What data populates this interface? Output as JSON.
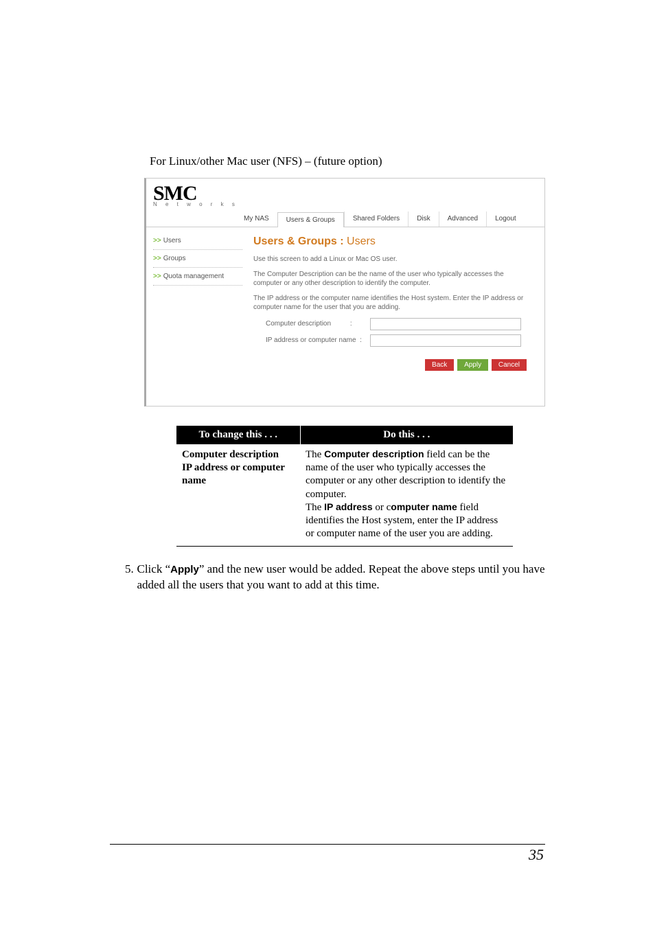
{
  "intro": "For Linux/other Mac user (NFS) – (future option)",
  "logo": {
    "text": "SMC",
    "sub": "N e t w o r k s"
  },
  "tabs": {
    "my_nas": "My NAS",
    "users_groups": "Users & Groups",
    "shared_folders": "Shared Folders",
    "disk": "Disk",
    "advanced": "Advanced",
    "logout": "Logout"
  },
  "sidebar": {
    "users": "Users",
    "groups": "Groups",
    "quota": "Quota management"
  },
  "panel": {
    "title_bold": "Users & Groups : ",
    "title_light": "Users",
    "d1": "Use this screen to add a Linux or Mac OS user.",
    "d2": "The Computer Description can be the name of the user who typically accesses the computer or any other description to identify the computer.",
    "d3": "The IP address or the computer name identifies the Host system. Enter the IP address or computer name for the user that you are adding.",
    "f_comp_desc": "Computer description",
    "f_ip": "IP address or computer name",
    "colon": ":",
    "btn_back": "Back",
    "btn_apply": "Apply",
    "btn_cancel": "Cancel"
  },
  "table": {
    "h1": "To change this . . .",
    "h2": "Do this . . .",
    "left": "Computer description\nIP address or computer name",
    "r_t1a": "The ",
    "r_t1b": "Computer description",
    "r_t1c": " field can be the name of the user who typically accesses the computer or any other description to identify the computer.",
    "r_t2a": "The ",
    "r_t2b": "IP address",
    "r_t2c": " or c",
    "r_t2d": "omputer name",
    "r_t2e": " field identifies the Host system, enter the IP address or computer name of the user you are adding."
  },
  "step": {
    "num": "5.",
    "a": "Click “",
    "b": "Apply",
    "c": "” and the new user would be added. Repeat the above steps until you have added all the users that you want to add at this time."
  },
  "page_number": "35"
}
